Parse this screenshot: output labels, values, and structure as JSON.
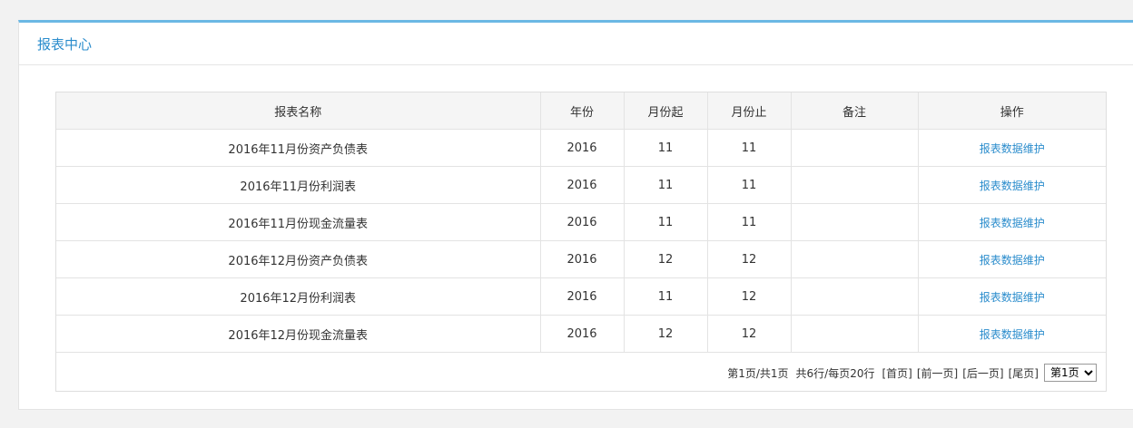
{
  "panel": {
    "title": "报表中心"
  },
  "table": {
    "headers": [
      "报表名称",
      "年份",
      "月份起",
      "月份止",
      "备注",
      "操作"
    ],
    "rows": [
      {
        "name": "2016年11月份资产负债表",
        "year": "2016",
        "start": "11",
        "end": "11",
        "note": "",
        "action": "报表数据维护"
      },
      {
        "name": "2016年11月份利润表",
        "year": "2016",
        "start": "11",
        "end": "11",
        "note": "",
        "action": "报表数据维护"
      },
      {
        "name": "2016年11月份现金流量表",
        "year": "2016",
        "start": "11",
        "end": "11",
        "note": "",
        "action": "报表数据维护"
      },
      {
        "name": "2016年12月份资产负债表",
        "year": "2016",
        "start": "12",
        "end": "12",
        "note": "",
        "action": "报表数据维护"
      },
      {
        "name": "2016年12月份利润表",
        "year": "2016",
        "start": "11",
        "end": "12",
        "note": "",
        "action": "报表数据维护"
      },
      {
        "name": "2016年12月份现金流量表",
        "year": "2016",
        "start": "12",
        "end": "12",
        "note": "",
        "action": "报表数据维护"
      }
    ]
  },
  "pager": {
    "page_info": "第1页/共1页",
    "row_info": "共6行/每页20行",
    "first": "[首页]",
    "prev": "[前一页]",
    "next": "[后一页]",
    "last": "[尾页]",
    "select_value": "第1页"
  }
}
